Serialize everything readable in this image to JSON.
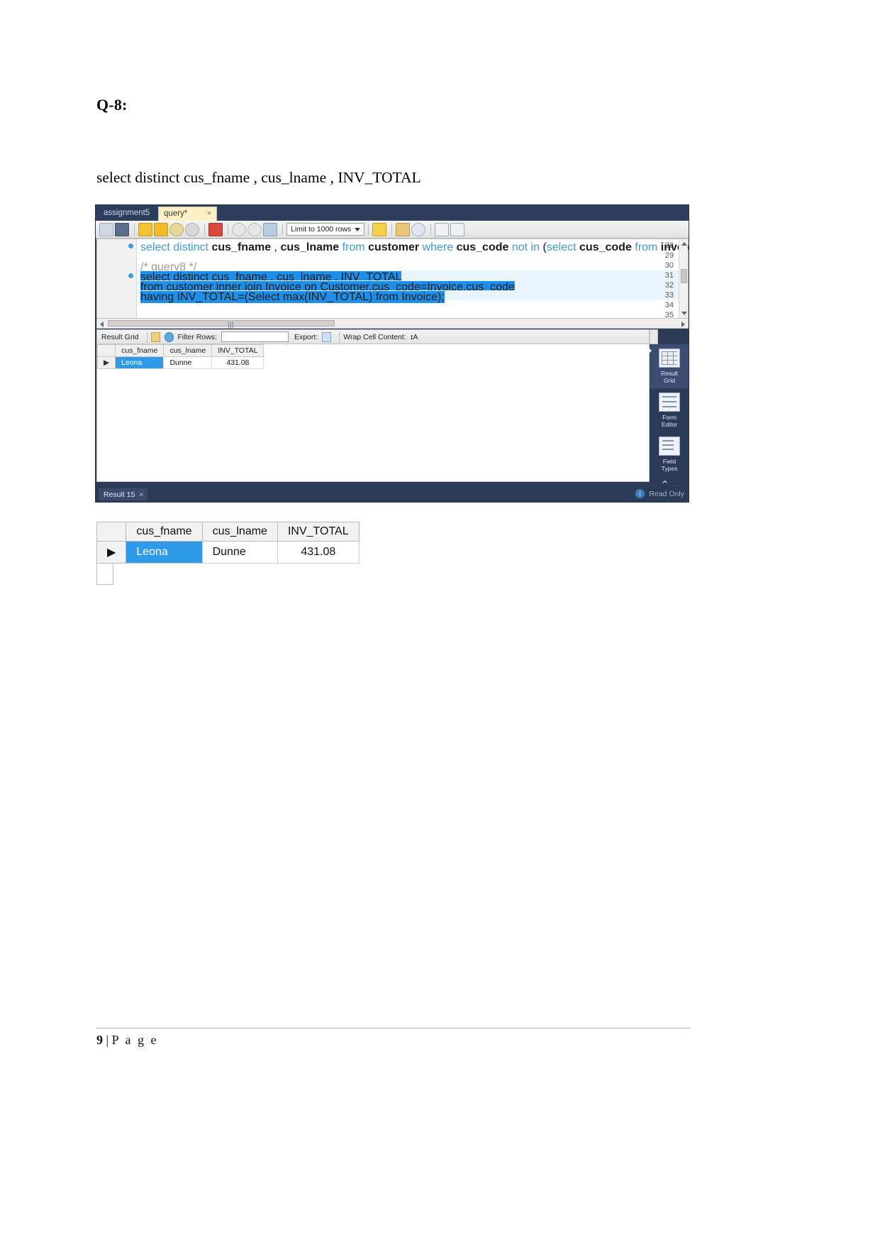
{
  "document": {
    "question_heading": "Q-8:",
    "query_lines": [
      "select distinct cus_fname , cus_lname , INV_TOTAL",
      "from customer inner join Invoice on Customer.cus_code=Invoice.cus_code",
      "having INV_TOTAL=(Select max(INV_TOTAL) from Invoice);"
    ],
    "footer": {
      "page_number": "9",
      "separator": "|",
      "page_word": "P a g e"
    }
  },
  "workbench": {
    "tabs": [
      {
        "label": "assignment5",
        "active": false
      },
      {
        "label": "query*",
        "active": true,
        "close": "×"
      }
    ],
    "toolbar": {
      "icons": [
        "open-folder-icon",
        "save-icon",
        "execute-bolt-icon",
        "execute-current-bolt-icon",
        "explain-magnifier-icon",
        "stop-clock-icon",
        "toggle-breakpoint-icon",
        "commit-check-icon",
        "rollback-x-icon",
        "autocommit-icon"
      ],
      "limit_select": "Limit to 1000 rows",
      "right_icons": [
        "beautify-star-icon",
        "paintbrush-icon",
        "find-icon",
        "invisible-chars-icon",
        "wrap-lines-icon"
      ]
    },
    "editor": {
      "lines": [
        {
          "number": "28",
          "breakpoint": true,
          "selected": false,
          "tokens": [
            {
              "t": "select",
              "c": "kw"
            },
            {
              "t": " ",
              "c": "plain"
            },
            {
              "t": "distinct",
              "c": "kw"
            },
            {
              "t": " ",
              "c": "plain"
            },
            {
              "t": "cus_fname",
              "c": "id"
            },
            {
              "t": " , ",
              "c": "plain"
            },
            {
              "t": "cus_lname",
              "c": "id"
            },
            {
              "t": " ",
              "c": "plain"
            },
            {
              "t": "from",
              "c": "kw"
            },
            {
              "t": " ",
              "c": "plain"
            },
            {
              "t": "customer",
              "c": "id"
            },
            {
              "t": " ",
              "c": "plain"
            },
            {
              "t": "where",
              "c": "kw"
            },
            {
              "t": " ",
              "c": "plain"
            },
            {
              "t": "cus_code",
              "c": "id"
            },
            {
              "t": " ",
              "c": "plain"
            },
            {
              "t": "not",
              "c": "kw"
            },
            {
              "t": " ",
              "c": "plain"
            },
            {
              "t": "in",
              "c": "kw"
            },
            {
              "t": " (",
              "c": "plain"
            },
            {
              "t": "select",
              "c": "kw"
            },
            {
              "t": " ",
              "c": "plain"
            },
            {
              "t": "cus_code",
              "c": "id"
            },
            {
              "t": " ",
              "c": "plain"
            },
            {
              "t": "from",
              "c": "kw"
            },
            {
              "t": " ",
              "c": "plain"
            },
            {
              "t": "invoice",
              "c": "id"
            },
            {
              "t": ");",
              "c": "plain"
            }
          ]
        },
        {
          "number": "29",
          "breakpoint": false,
          "selected": false,
          "tokens": []
        },
        {
          "number": "30",
          "breakpoint": false,
          "selected": false,
          "tokens": [
            {
              "t": "/* query8 */",
              "c": "cmt"
            }
          ]
        },
        {
          "number": "31",
          "breakpoint": true,
          "selected": true,
          "tokens": [
            {
              "t": "select distinct cus_fname , cus_lname , INV_TOTAL",
              "c": "plain"
            }
          ]
        },
        {
          "number": "32",
          "breakpoint": false,
          "selected": true,
          "tokens": [
            {
              "t": "from customer inner join Invoice on Customer.cus_code=Invoice.cus_code",
              "c": "plain"
            }
          ]
        },
        {
          "number": "33",
          "breakpoint": false,
          "selected": true,
          "tokens": [
            {
              "t": "having INV_TOTAL=(Select max(INV_TOTAL) from Invoice);",
              "c": "plain"
            }
          ]
        },
        {
          "number": "34",
          "breakpoint": false,
          "selected": false,
          "tokens": []
        },
        {
          "number": "35",
          "breakpoint": false,
          "selected": false,
          "tokens": []
        }
      ],
      "hscroll_marker": "|||"
    },
    "result_panel": {
      "title": "Result Grid",
      "filter_label": "Filter Rows:",
      "filter_value": "",
      "export_label": "Export:",
      "wrap_label": "Wrap Cell Content:",
      "wrap_glyph": "ɪA"
    },
    "result_table": {
      "columns": [
        "cus_fname",
        "cus_lname",
        "INV_TOTAL"
      ],
      "rows": [
        {
          "marker": "▶",
          "cells": [
            "Leona",
            "Dunne",
            "431.08"
          ],
          "selected_cell": 0
        }
      ]
    },
    "sidebar": [
      {
        "label_1": "Result",
        "label_2": "Grid",
        "icon": "result-grid-icon",
        "active": true
      },
      {
        "label_1": "Form",
        "label_2": "Editor",
        "icon": "form-editor-icon",
        "active": false
      },
      {
        "label_1": "Field",
        "label_2": "Types",
        "icon": "field-types-icon",
        "active": false
      }
    ],
    "status_bar": {
      "result_tab": "Result 15",
      "result_tab_close": "×",
      "info_glyph": "i",
      "read_only": "Read Only"
    }
  },
  "standalone_table": {
    "columns": [
      "cus_fname",
      "cus_lname",
      "INV_TOTAL"
    ],
    "rows": [
      {
        "marker": "▶",
        "cells": [
          "Leona",
          "Dunne",
          "431.08"
        ],
        "selected_cell": 0
      }
    ]
  },
  "colors": {
    "chrome": "#2b3a57",
    "selection_blue": "#1e8fe8",
    "tab_yellow": "#fdf0c4",
    "keyword": "#3c9ad6"
  }
}
